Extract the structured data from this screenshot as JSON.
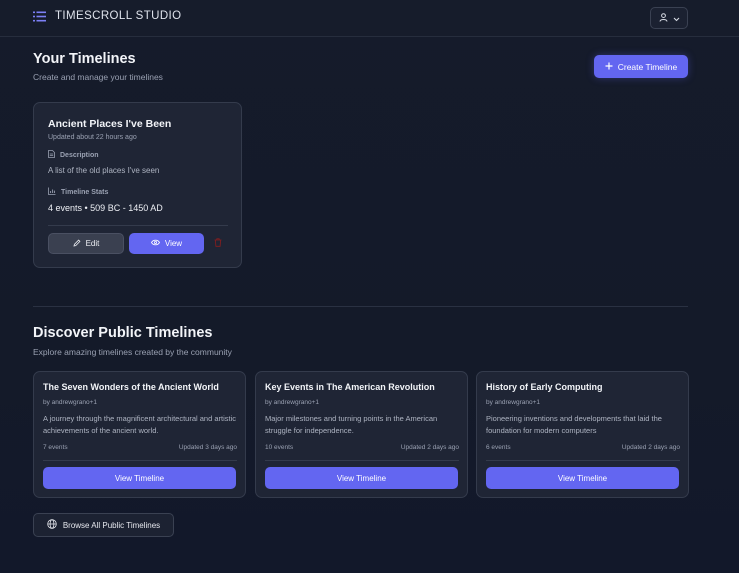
{
  "app": {
    "name": "TIMESCROLL STUDIO"
  },
  "colors": {
    "accent": "#6366f1",
    "background": "#151b2b",
    "card": "#1f2535",
    "danger": "#b91c1c"
  },
  "header": {
    "menu_icon": "list-icon",
    "user_icon": "user-icon",
    "chevron_icon": "chevron-down-icon"
  },
  "your_timelines": {
    "title": "Your Timelines",
    "subtitle": "Create and manage your timelines",
    "create_label": "Create Timeline",
    "cards": [
      {
        "title": "Ancient Places I've Been",
        "updated": "Updated about 22 hours ago",
        "description_label": "Description",
        "description": "A list of the old places I've seen",
        "stats_label": "Timeline Stats",
        "stats": "4 events • 509 BC - 1450 AD",
        "edit_label": "Edit",
        "view_label": "View"
      }
    ]
  },
  "discover": {
    "title": "Discover Public Timelines",
    "subtitle": "Explore amazing timelines created by the community",
    "cards": [
      {
        "title": "The Seven Wonders of the Ancient World",
        "author": "by andrewgrano+1",
        "description": "A journey through the magnificent architectural and artistic achievements of the ancient world.",
        "events": "7 events",
        "updated": "Updated 3 days ago",
        "button": "View Timeline"
      },
      {
        "title": "Key Events in The American Revolution",
        "author": "by andrewgrano+1",
        "description": "Major milestones and turning points in the American struggle for independence.",
        "events": "10 events",
        "updated": "Updated 2 days ago",
        "button": "View Timeline"
      },
      {
        "title": "History of Early Computing",
        "author": "by andrewgrano+1",
        "description": "Pioneering inventions and developments that laid the foundation for modern computers",
        "events": "6 events",
        "updated": "Updated 2 days ago",
        "button": "View Timeline"
      }
    ],
    "browse_label": "Browse All Public Timelines"
  }
}
